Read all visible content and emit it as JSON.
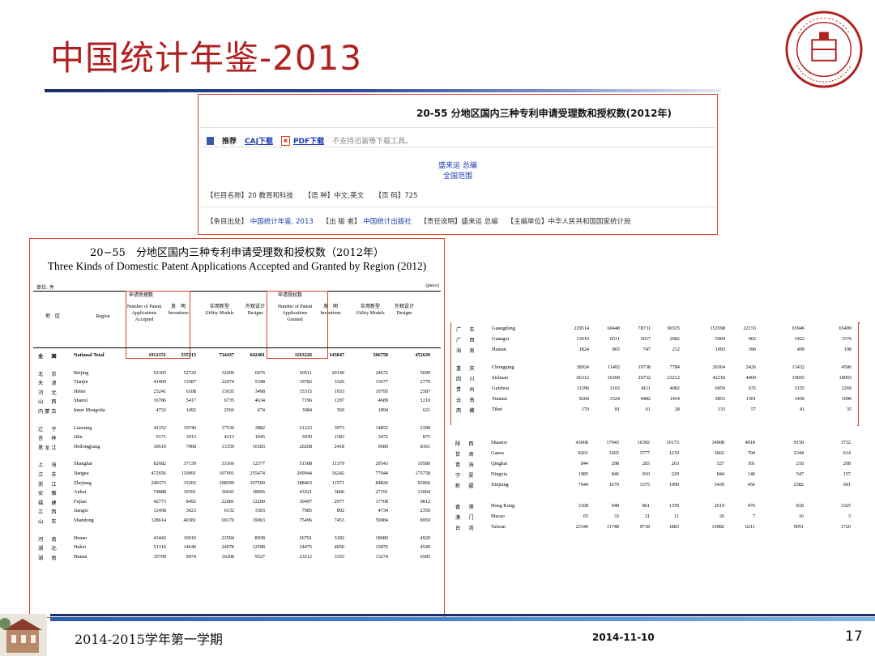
{
  "slide": {
    "title": "中国统计年鉴-2013",
    "footer_term": "2014-2015学年第一学期",
    "footer_date": "2014-11-10",
    "page_number": "17",
    "accent_color": "#b0201f",
    "border_color": "#d9442b"
  },
  "web_panel": {
    "heading": "20-55 分地区国内三种专利申请受理数和授权数(2012年)",
    "recommend": "推荐",
    "caj_link": "CAJ下载",
    "pdf_link": "PDF下载",
    "note": "不支持迅雷等下载工具。",
    "author": "盛来运 总编",
    "scope": "全国范围",
    "meta_column": "【栏目名称】20 教育和科技",
    "meta_lang": "【语 种】中文;英文",
    "meta_page": "【页 码】725",
    "meta_source_label": "【条目出处】",
    "meta_source": "中国统计年鉴, 2013",
    "meta_publisher_label": "【出 版 者】",
    "meta_publisher": "中国统计出版社",
    "meta_resp": "【责任说明】盛来运 总编",
    "meta_editor": "【主编单位】中华人民共和国国家统计局"
  },
  "table": {
    "title_cn": "20−55　分地区国内三种专利申请受理数和授权数（2012年）",
    "title_en": "Three Kinds of Domestic Patent Applications Accepted and Granted by Region (2012)",
    "unit": "单位: 件",
    "unit_en": "(piece)",
    "col_region_cn": "地　区",
    "col_region_en": "Region",
    "grp_accepted": "申请受理数",
    "grp_granted": "申请授权数",
    "h_num_acc": "Number of Patent Applications Accepted",
    "h_inv": "发　明 Inventions",
    "h_util": "实用新型 Utility Models",
    "h_design": "外观设计 Designs",
    "h_num_gr": "Number of Patent Applications Granted",
    "rows": [
      {
        "cn": "全　国",
        "en": "National Total",
        "v": [
          "1912151",
          "535313",
          "734437",
          "642401",
          "1163226",
          "143847",
          "566750",
          "452629"
        ],
        "total": true
      },
      {
        "cn": "北　京",
        "en": "Beijing",
        "v": [
          "92305",
          "52720",
          "32609",
          "6976",
          "50511",
          "20140",
          "24672",
          "5699"
        ]
      },
      {
        "cn": "天　津",
        "en": "Tianjin",
        "v": [
          "41009",
          "13587",
          "22074",
          "5348",
          "19782",
          "3326",
          "13677",
          "2779"
        ]
      },
      {
        "cn": "河　北",
        "en": "Hebei",
        "v": [
          "23241",
          "6108",
          "13635",
          "3498",
          "15315",
          "1933",
          "10795",
          "2587"
        ]
      },
      {
        "cn": "山　西",
        "en": "Shanxi",
        "v": [
          "16786",
          "5417",
          "6735",
          "4634",
          "7196",
          "1297",
          "4689",
          "1210"
        ]
      },
      {
        "cn": "内蒙古",
        "en": "Inner Mongolia",
        "v": [
          "4732",
          "1492",
          "2566",
          "674",
          "3084",
          "569",
          "1894",
          "621"
        ]
      },
      {
        "cn": "辽　宁",
        "en": "Liaoning",
        "v": [
          "41152",
          "19740",
          "17530",
          "3882",
          "21223",
          "3973",
          "14852",
          "2398"
        ]
      },
      {
        "cn": "吉　林",
        "en": "Jilin",
        "v": [
          "9171",
          "3913",
          "4213",
          "1045",
          "5930",
          "1583",
          "3472",
          "875"
        ]
      },
      {
        "cn": "黑龙江",
        "en": "Heilongjiang",
        "v": [
          "30610",
          "7068",
          "13359",
          "10183",
          "20268",
          "2418",
          "9689",
          "8161"
        ]
      },
      {
        "cn": "上　海",
        "en": "Shanghai",
        "v": [
          "82682",
          "37139",
          "33166",
          "12377",
          "51508",
          "11379",
          "29543",
          "10586"
        ]
      },
      {
        "cn": "江　苏",
        "en": "Jiangsu",
        "v": [
          "472656",
          "110091",
          "107091",
          "255474",
          "269944",
          "16242",
          "77944",
          "175758"
        ]
      },
      {
        "cn": "浙　江",
        "en": "Zhejiang",
        "v": [
          "249373",
          "33265",
          "108599",
          "107509",
          "188463",
          "11571",
          "84826",
          "92066"
        ]
      },
      {
        "cn": "安　徽",
        "en": "Anhui",
        "v": [
          "74888",
          "19391",
          "36641",
          "18856",
          "43321",
          "3066",
          "27191",
          "13064"
        ]
      },
      {
        "cn": "福　建",
        "en": "Fujian",
        "v": [
          "42773",
          "8492",
          "22081",
          "12200",
          "30497",
          "2977",
          "17708",
          "9812"
        ]
      },
      {
        "cn": "江　西",
        "en": "Jiangxi",
        "v": [
          "12458",
          "3023",
          "6132",
          "3303",
          "7985",
          "892",
          "4734",
          "2359"
        ]
      },
      {
        "cn": "山　东",
        "en": "Shandong",
        "v": [
          "128614",
          "40381",
          "69170",
          "19063",
          "75496",
          "7453",
          "59084",
          "8959"
        ]
      },
      {
        "cn": "河　南",
        "en": "Henan",
        "v": [
          "43442",
          "10910",
          "23594",
          "8938",
          "26791",
          "3182",
          "18680",
          "4929"
        ]
      },
      {
        "cn": "湖　北",
        "en": "Hubei",
        "v": [
          "51316",
          "14640",
          "24078",
          "12598",
          "24475",
          "4050",
          "15876",
          "4549"
        ]
      },
      {
        "cn": "湖　南",
        "en": "Hunan",
        "v": [
          "35709",
          "9974",
          "16208",
          "9527",
          "23212",
          "3353",
          "13274",
          "6585"
        ]
      }
    ]
  },
  "table2": {
    "rows": [
      {
        "cn": "广　东",
        "en": "Guangdong",
        "v": [
          "229514",
          "60448",
          "78731",
          "90335",
          "153598",
          "22153",
          "65946",
          "65499"
        ]
      },
      {
        "cn": "广　西",
        "en": "Guangxi",
        "v": [
          "13610",
          "6511",
          "5017",
          "2082",
          "5900",
          "902",
          "3422",
          "1576"
        ]
      },
      {
        "cn": "海　南",
        "en": "Hainan",
        "v": [
          "1824",
          "865",
          "747",
          "212",
          "1093",
          "396",
          "499",
          "198"
        ]
      },
      {
        "cn": "重　庆",
        "en": "Chongqing",
        "v": [
          "38924",
          "11402",
          "19738",
          "7784",
          "20364",
          "2426",
          "13432",
          "4506"
        ]
      },
      {
        "cn": "四　川",
        "en": "Sichuan",
        "v": [
          "66312",
          "16368",
          "26732",
          "23212",
          "42218",
          "4460",
          "19665",
          "18093"
        ]
      },
      {
        "cn": "贵　州",
        "en": "Guizhou",
        "v": [
          "11296",
          "3103",
          "4111",
          "4082",
          "6059",
          "635",
          "3155",
          "2269"
        ]
      },
      {
        "cn": "云　南",
        "en": "Yunnan",
        "v": [
          "9260",
          "3324",
          "4482",
          "1454",
          "5853",
          "1301",
          "3456",
          "1096"
        ]
      },
      {
        "cn": "西　藏",
        "en": "Tibet",
        "v": [
          "170",
          "81",
          "61",
          "28",
          "133",
          "57",
          "41",
          "35"
        ]
      },
      {
        "cn": "陕　西",
        "en": "Shaanxi",
        "v": [
          "43608",
          "17043",
          "16392",
          "10173",
          "14908",
          "4018",
          "9158",
          "1732"
        ]
      },
      {
        "cn": "甘　肃",
        "en": "Gansu",
        "v": [
          "8261",
          "3265",
          "3777",
          "1219",
          "3662",
          "704",
          "2344",
          "614"
        ]
      },
      {
        "cn": "青　海",
        "en": "Qinghai",
        "v": [
          "844",
          "298",
          "283",
          "263",
          "527",
          "101",
          "218",
          "208"
        ]
      },
      {
        "cn": "宁　夏",
        "en": "Ningxia",
        "v": [
          "1985",
          "846",
          "910",
          "229",
          "844",
          "140",
          "547",
          "157"
        ]
      },
      {
        "cn": "新　疆",
        "en": "Xinjiang",
        "v": [
          "7044",
          "1679",
          "3375",
          "1990",
          "3439",
          "456",
          "2382",
          "601"
        ]
      },
      {
        "cn": "香　港",
        "en": "Hong Kong",
        "v": [
          "3168",
          "948",
          "861",
          "1359",
          "2619",
          "476",
          "818",
          "1325"
        ]
      },
      {
        "cn": "澳　门",
        "en": "Macao",
        "v": [
          "65",
          "33",
          "21",
          "11",
          "26",
          "7",
          "16",
          "3"
        ]
      },
      {
        "cn": "台　湾",
        "en": "Taiwan",
        "v": [
          "23349",
          "11748",
          "9718",
          "1883",
          "16982",
          "6211",
          "9051",
          "1720"
        ]
      }
    ]
  }
}
